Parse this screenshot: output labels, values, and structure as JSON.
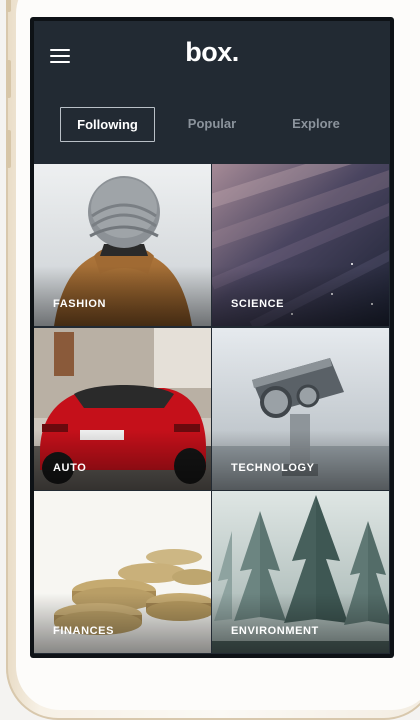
{
  "app": {
    "title": "box."
  },
  "tabs": [
    {
      "label": "Following",
      "active": true
    },
    {
      "label": "Popular",
      "active": false
    },
    {
      "label": "Explore",
      "active": false
    }
  ],
  "categories": [
    {
      "label": "FASHION"
    },
    {
      "label": "SCIENCE"
    },
    {
      "label": "AUTO"
    },
    {
      "label": "TECHNOLOGY"
    },
    {
      "label": "FINANCES"
    },
    {
      "label": "ENVIRONMENT"
    }
  ],
  "colors": {
    "app_background": "#222a33",
    "tab_active_text": "#ffffff",
    "tab_inactive_text": "#8b939c",
    "tile_label": "#ffffff"
  },
  "icons": {
    "menu": "hamburger-menu-icon"
  }
}
